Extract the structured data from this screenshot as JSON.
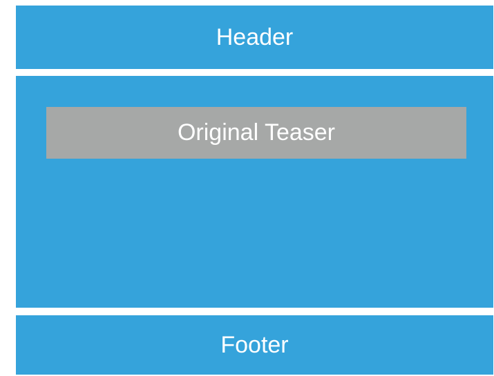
{
  "header": {
    "label": "Header"
  },
  "main": {
    "teaser": {
      "label": "Original Teaser"
    }
  },
  "footer": {
    "label": "Footer"
  },
  "colors": {
    "region_blue": "#35a3db",
    "teaser_gray": "#a6a8a7",
    "text": "#ffffff",
    "background": "#ffffff"
  }
}
